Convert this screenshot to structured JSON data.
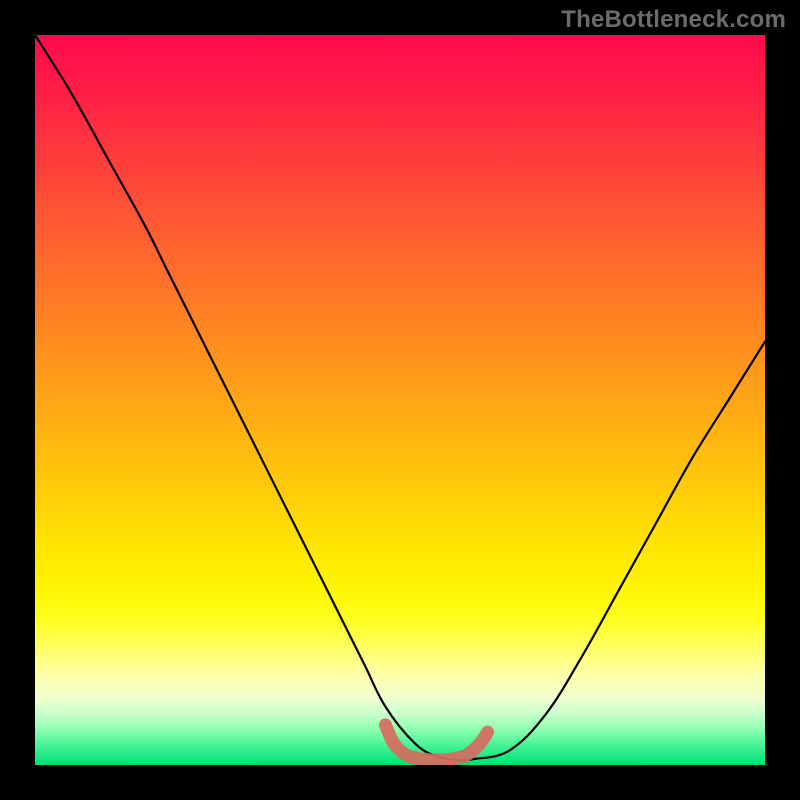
{
  "watermark": {
    "text": "TheBottleneck.com"
  },
  "colors": {
    "page_bg": "#000000",
    "gradient_top": "#ff0a4d",
    "gradient_mid": "#ffe402",
    "gradient_bottom": "#00e070",
    "curve_black": "#000000",
    "curve_salmon": "#d86a60"
  },
  "chart_data": {
    "type": "line",
    "title": "",
    "xlabel": "",
    "ylabel": "",
    "xlim": [
      0,
      100
    ],
    "ylim": [
      0,
      100
    ],
    "grid": false,
    "legend_position": "none",
    "annotations": [
      "TheBottleneck.com"
    ],
    "series": [
      {
        "name": "black_curve",
        "color": "#000000",
        "type": "line",
        "x": [
          0,
          5,
          10,
          15,
          18,
          22,
          26,
          30,
          35,
          40,
          45,
          48,
          52,
          55,
          58,
          60,
          65,
          70,
          75,
          80,
          85,
          90,
          95,
          100
        ],
        "y": [
          100,
          92,
          83,
          74,
          68,
          60,
          52,
          44,
          34,
          24,
          14,
          8,
          3,
          1.2,
          0.7,
          0.8,
          2,
          7,
          15,
          24,
          33,
          42,
          50,
          58
        ]
      },
      {
        "name": "salmon_valley_band",
        "color": "#d86a60",
        "type": "line",
        "x": [
          48,
          49,
          50,
          51,
          52,
          53,
          54,
          55,
          56,
          57,
          58,
          59,
          60,
          61,
          62
        ],
        "y": [
          5.5,
          3.2,
          2.0,
          1.3,
          1.0,
          0.8,
          0.7,
          0.7,
          0.7,
          0.8,
          1.0,
          1.3,
          2.0,
          3.0,
          4.5
        ]
      }
    ]
  }
}
